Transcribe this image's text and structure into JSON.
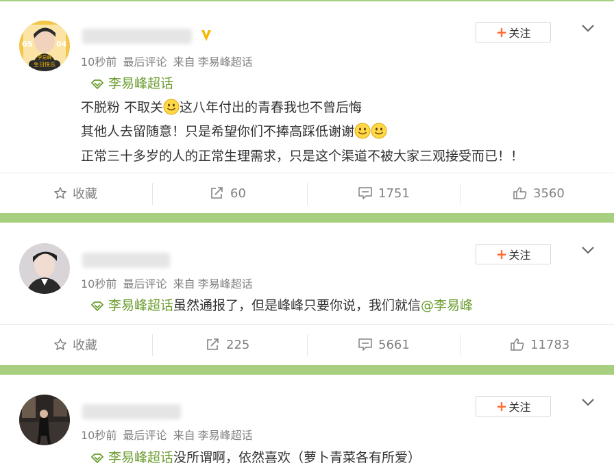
{
  "posts": [
    {
      "meta": {
        "time": "10秒前",
        "sort": "最后评论",
        "from": "来自",
        "source": "李易峰超话"
      },
      "follow_label": "关注",
      "avatar_badge": {
        "left": "05",
        "right": "04",
        "top": "李易峰",
        "bottom": "生日快乐"
      },
      "topic_label": "李易峰超话",
      "lines": [
        "不脱粉 不取关",
        "这八年付出的青春我也不曾后悔",
        "其他人去留随意！只是希望你们不捧高踩低谢谢",
        "正常三十多岁的人的正常生理需求，只是这个渠道不被大家三观接受而已！！"
      ],
      "actions": {
        "favorite": "收藏",
        "repost": "60",
        "comment": "1751",
        "like": "3560"
      }
    },
    {
      "meta": {
        "time": "10秒前",
        "sort": "最后评论",
        "from": "来自",
        "source": "李易峰超话"
      },
      "follow_label": "关注",
      "topic_label": "李易峰超话",
      "text": "虽然通报了，但是峰峰只要你说，我们就信",
      "mention": "@李易峰",
      "actions": {
        "favorite": "收藏",
        "repost": "225",
        "comment": "5661",
        "like": "11783"
      }
    },
    {
      "meta": {
        "time": "10秒前",
        "sort": "最后评论",
        "from": "来自",
        "source": "李易峰超话"
      },
      "follow_label": "关注",
      "topic_label": "李易峰超话",
      "text": "没所谓啊，依然喜欢（萝卜青菜各有所爱）"
    }
  ],
  "colors": {
    "topic": "#6a9c2e",
    "separator": "#a8cf7f",
    "follow_plus": "#ff6a2c",
    "meta": "#808080",
    "badge": "#f5b800"
  },
  "icons": [
    "star-icon",
    "repost-icon",
    "comment-icon",
    "like-icon",
    "chevron-down-icon",
    "topic-diamond-icon",
    "smile-emoji-icon",
    "verified-badge-icon"
  ]
}
